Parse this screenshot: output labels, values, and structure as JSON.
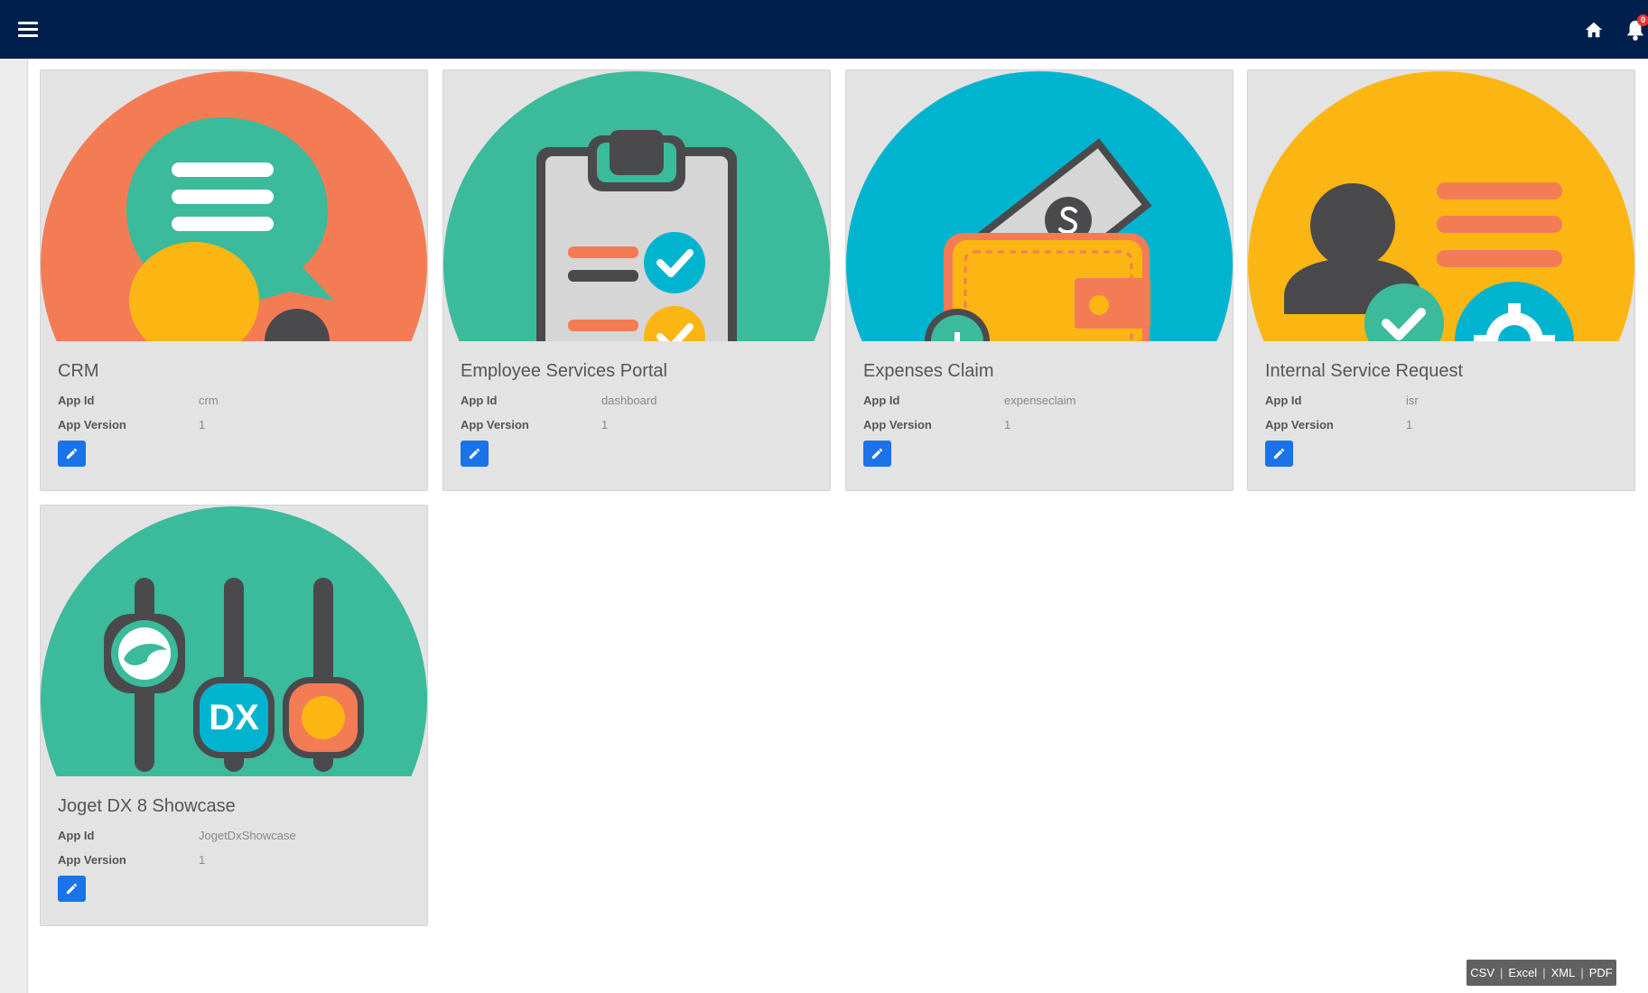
{
  "header": {
    "notifications_count": "0"
  },
  "apps": [
    {
      "title": "CRM",
      "app_id_label": "App Id",
      "app_id": "crm",
      "app_version_label": "App Version",
      "app_version": "1"
    },
    {
      "title": "Employee Services Portal",
      "app_id_label": "App Id",
      "app_id": "dashboard",
      "app_version_label": "App Version",
      "app_version": "1"
    },
    {
      "title": "Expenses Claim",
      "app_id_label": "App Id",
      "app_id": "expenseclaim",
      "app_version_label": "App Version",
      "app_version": "1"
    },
    {
      "title": "Internal Service Request",
      "app_id_label": "App Id",
      "app_id": "isr",
      "app_version_label": "App Version",
      "app_version": "1"
    },
    {
      "title": "Joget DX 8 Showcase",
      "app_id_label": "App Id",
      "app_id": "JogetDxShowcase",
      "app_version_label": "App Version",
      "app_version": "1"
    }
  ],
  "art_text": {
    "showcase_badge": "DX"
  },
  "export": {
    "csv": "CSV",
    "excel": "Excel",
    "xml": "XML",
    "pdf": "PDF",
    "separator": "|"
  },
  "colors": {
    "topbar": "#001f4d",
    "crm": "#f47c55",
    "esp": "#3bba9c",
    "expenses": "#00b4d0",
    "isr": "#fbb614",
    "showcase": "#3bba9c",
    "edit_button": "#1a73e8"
  },
  "icons": [
    "menu-icon",
    "home-icon",
    "bell-icon",
    "pencil-icon"
  ]
}
